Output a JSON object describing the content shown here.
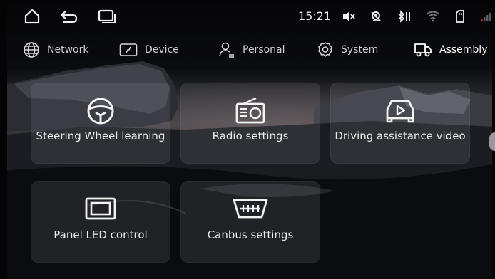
{
  "status_bar": {
    "time": "15:21",
    "icons": [
      "home-icon",
      "back-icon",
      "recent-apps-icon",
      "mute-icon",
      "location-off-icon",
      "bluetooth-icon",
      "wifi-icon",
      "sd-card-icon",
      "signal-icon"
    ]
  },
  "tabs": [
    {
      "label": "Network",
      "icon": "globe-icon",
      "active": false
    },
    {
      "label": "Device",
      "icon": "device-icon",
      "active": false
    },
    {
      "label": "Personal",
      "icon": "person-icon",
      "active": false
    },
    {
      "label": "System",
      "icon": "gear-icon",
      "active": false
    },
    {
      "label": "Assembly",
      "icon": "truck-icon",
      "active": true
    }
  ],
  "tiles": [
    {
      "label": "Steering Wheel learning",
      "icon": "steering-wheel-icon"
    },
    {
      "label": "Radio settings",
      "icon": "radio-icon"
    },
    {
      "label": "Driving assistance video",
      "icon": "car-camera-icon"
    },
    {
      "label": "Panel LED control",
      "icon": "panel-icon"
    },
    {
      "label": "Canbus settings",
      "icon": "canbus-connector-icon"
    }
  ],
  "colors": {
    "accent": "#ffffff",
    "tile_bg": "rgba(150,150,160,0.16)",
    "text": "#ececec"
  }
}
